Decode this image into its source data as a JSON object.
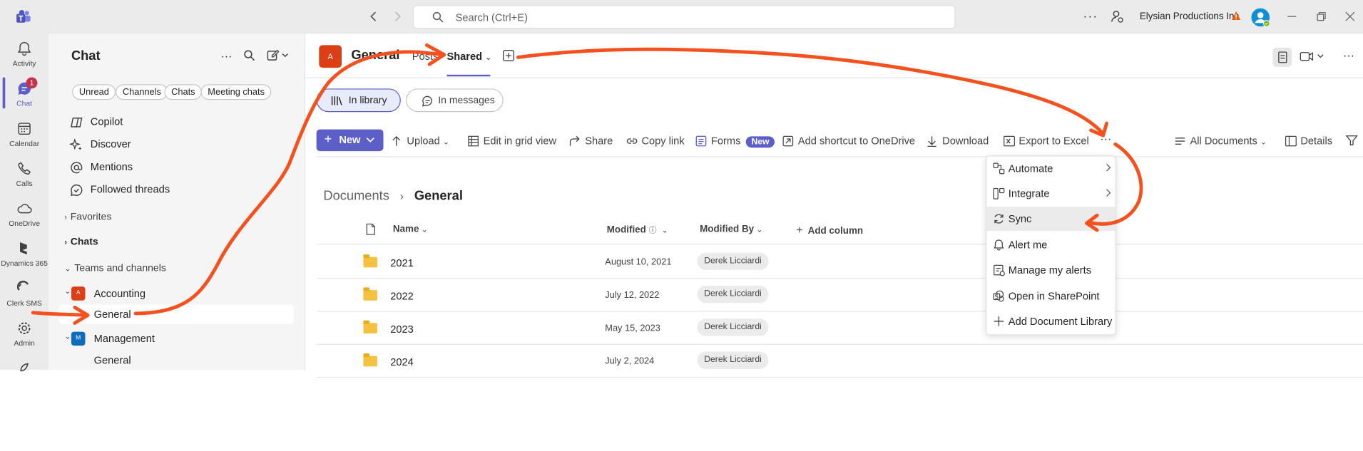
{
  "titlebar": {
    "search_placeholder": "Search (Ctrl+E)",
    "org_name": "Elysian Productions Inc"
  },
  "rail": {
    "items": [
      {
        "label": "Activity"
      },
      {
        "label": "Chat",
        "badge": "1"
      },
      {
        "label": "Calendar"
      },
      {
        "label": "Calls"
      },
      {
        "label": "OneDrive"
      },
      {
        "label": "Dynamics 365"
      },
      {
        "label": "Clerk SMS"
      },
      {
        "label": "Admin"
      }
    ]
  },
  "chat": {
    "title": "Chat",
    "filters": [
      "Unread",
      "Channels",
      "Chats",
      "Meeting chats"
    ],
    "nav": [
      "Copilot",
      "Discover",
      "Mentions",
      "Followed threads"
    ],
    "favorites": "Favorites",
    "chats": "Chats",
    "teams_header": "Teams and channels",
    "teams": [
      {
        "name": "Accounting",
        "avatar": "A",
        "channel": "General"
      },
      {
        "name": "Management",
        "avatar": "M",
        "channel": "General"
      }
    ]
  },
  "header": {
    "avatar": "A",
    "channel_name": "General",
    "tabs": [
      "Posts",
      "Shared"
    ]
  },
  "library_toggle": {
    "in_library": "In library",
    "in_messages": "In messages"
  },
  "toolbar": {
    "new": "New",
    "upload": "Upload",
    "edit_grid": "Edit in grid view",
    "share": "Share",
    "copy_link": "Copy link",
    "forms": "Forms",
    "forms_badge": "New",
    "shortcut": "Add shortcut to OneDrive",
    "download": "Download",
    "export": "Export to Excel",
    "all_documents": "All Documents",
    "details": "Details"
  },
  "breadcrumb": {
    "root": "Documents",
    "current": "General"
  },
  "columns": {
    "name": "Name",
    "modified": "Modified",
    "modified_by": "Modified By",
    "add_column": "Add column"
  },
  "rows": [
    {
      "name": "2021",
      "modified": "August 10, 2021",
      "by": "Derek Licciardi"
    },
    {
      "name": "2022",
      "modified": "July 12, 2022",
      "by": "Derek Licciardi"
    },
    {
      "name": "2023",
      "modified": "May 15, 2023",
      "by": "Derek Licciardi"
    },
    {
      "name": "2024",
      "modified": "July 2, 2024",
      "by": "Derek Licciardi"
    }
  ],
  "menu": {
    "items": [
      "Automate",
      "Integrate",
      "Sync",
      "Alert me",
      "Manage my alerts",
      "Open in SharePoint",
      "Add Document Library"
    ]
  },
  "colors": {
    "accent": "#5b5fc7",
    "annotation": "#f4511e",
    "badge": "#c4314b",
    "team_accounting": "#dc3e15",
    "team_management": "#0f6cbd"
  }
}
